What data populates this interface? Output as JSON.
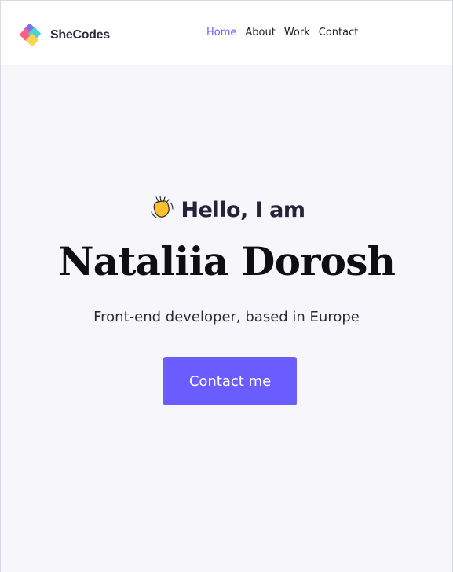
{
  "brand": {
    "name": "SheCodes"
  },
  "nav": {
    "items": [
      {
        "label": "Home",
        "active": true
      },
      {
        "label": "About",
        "active": false
      },
      {
        "label": "Work",
        "active": false
      },
      {
        "label": "Contact",
        "active": false
      }
    ]
  },
  "hero": {
    "greeting": "Hello, I am",
    "greeting_icon": "waving-hand-icon",
    "name": "Nataliia Dorosh",
    "tagline": "Front-end developer, based in Europe",
    "cta_label": "Contact me"
  },
  "colors": {
    "accent": "#6b5cff",
    "active_nav": "#6a5cf6",
    "background": "#f7f6fb",
    "header_bg": "#ffffff"
  }
}
